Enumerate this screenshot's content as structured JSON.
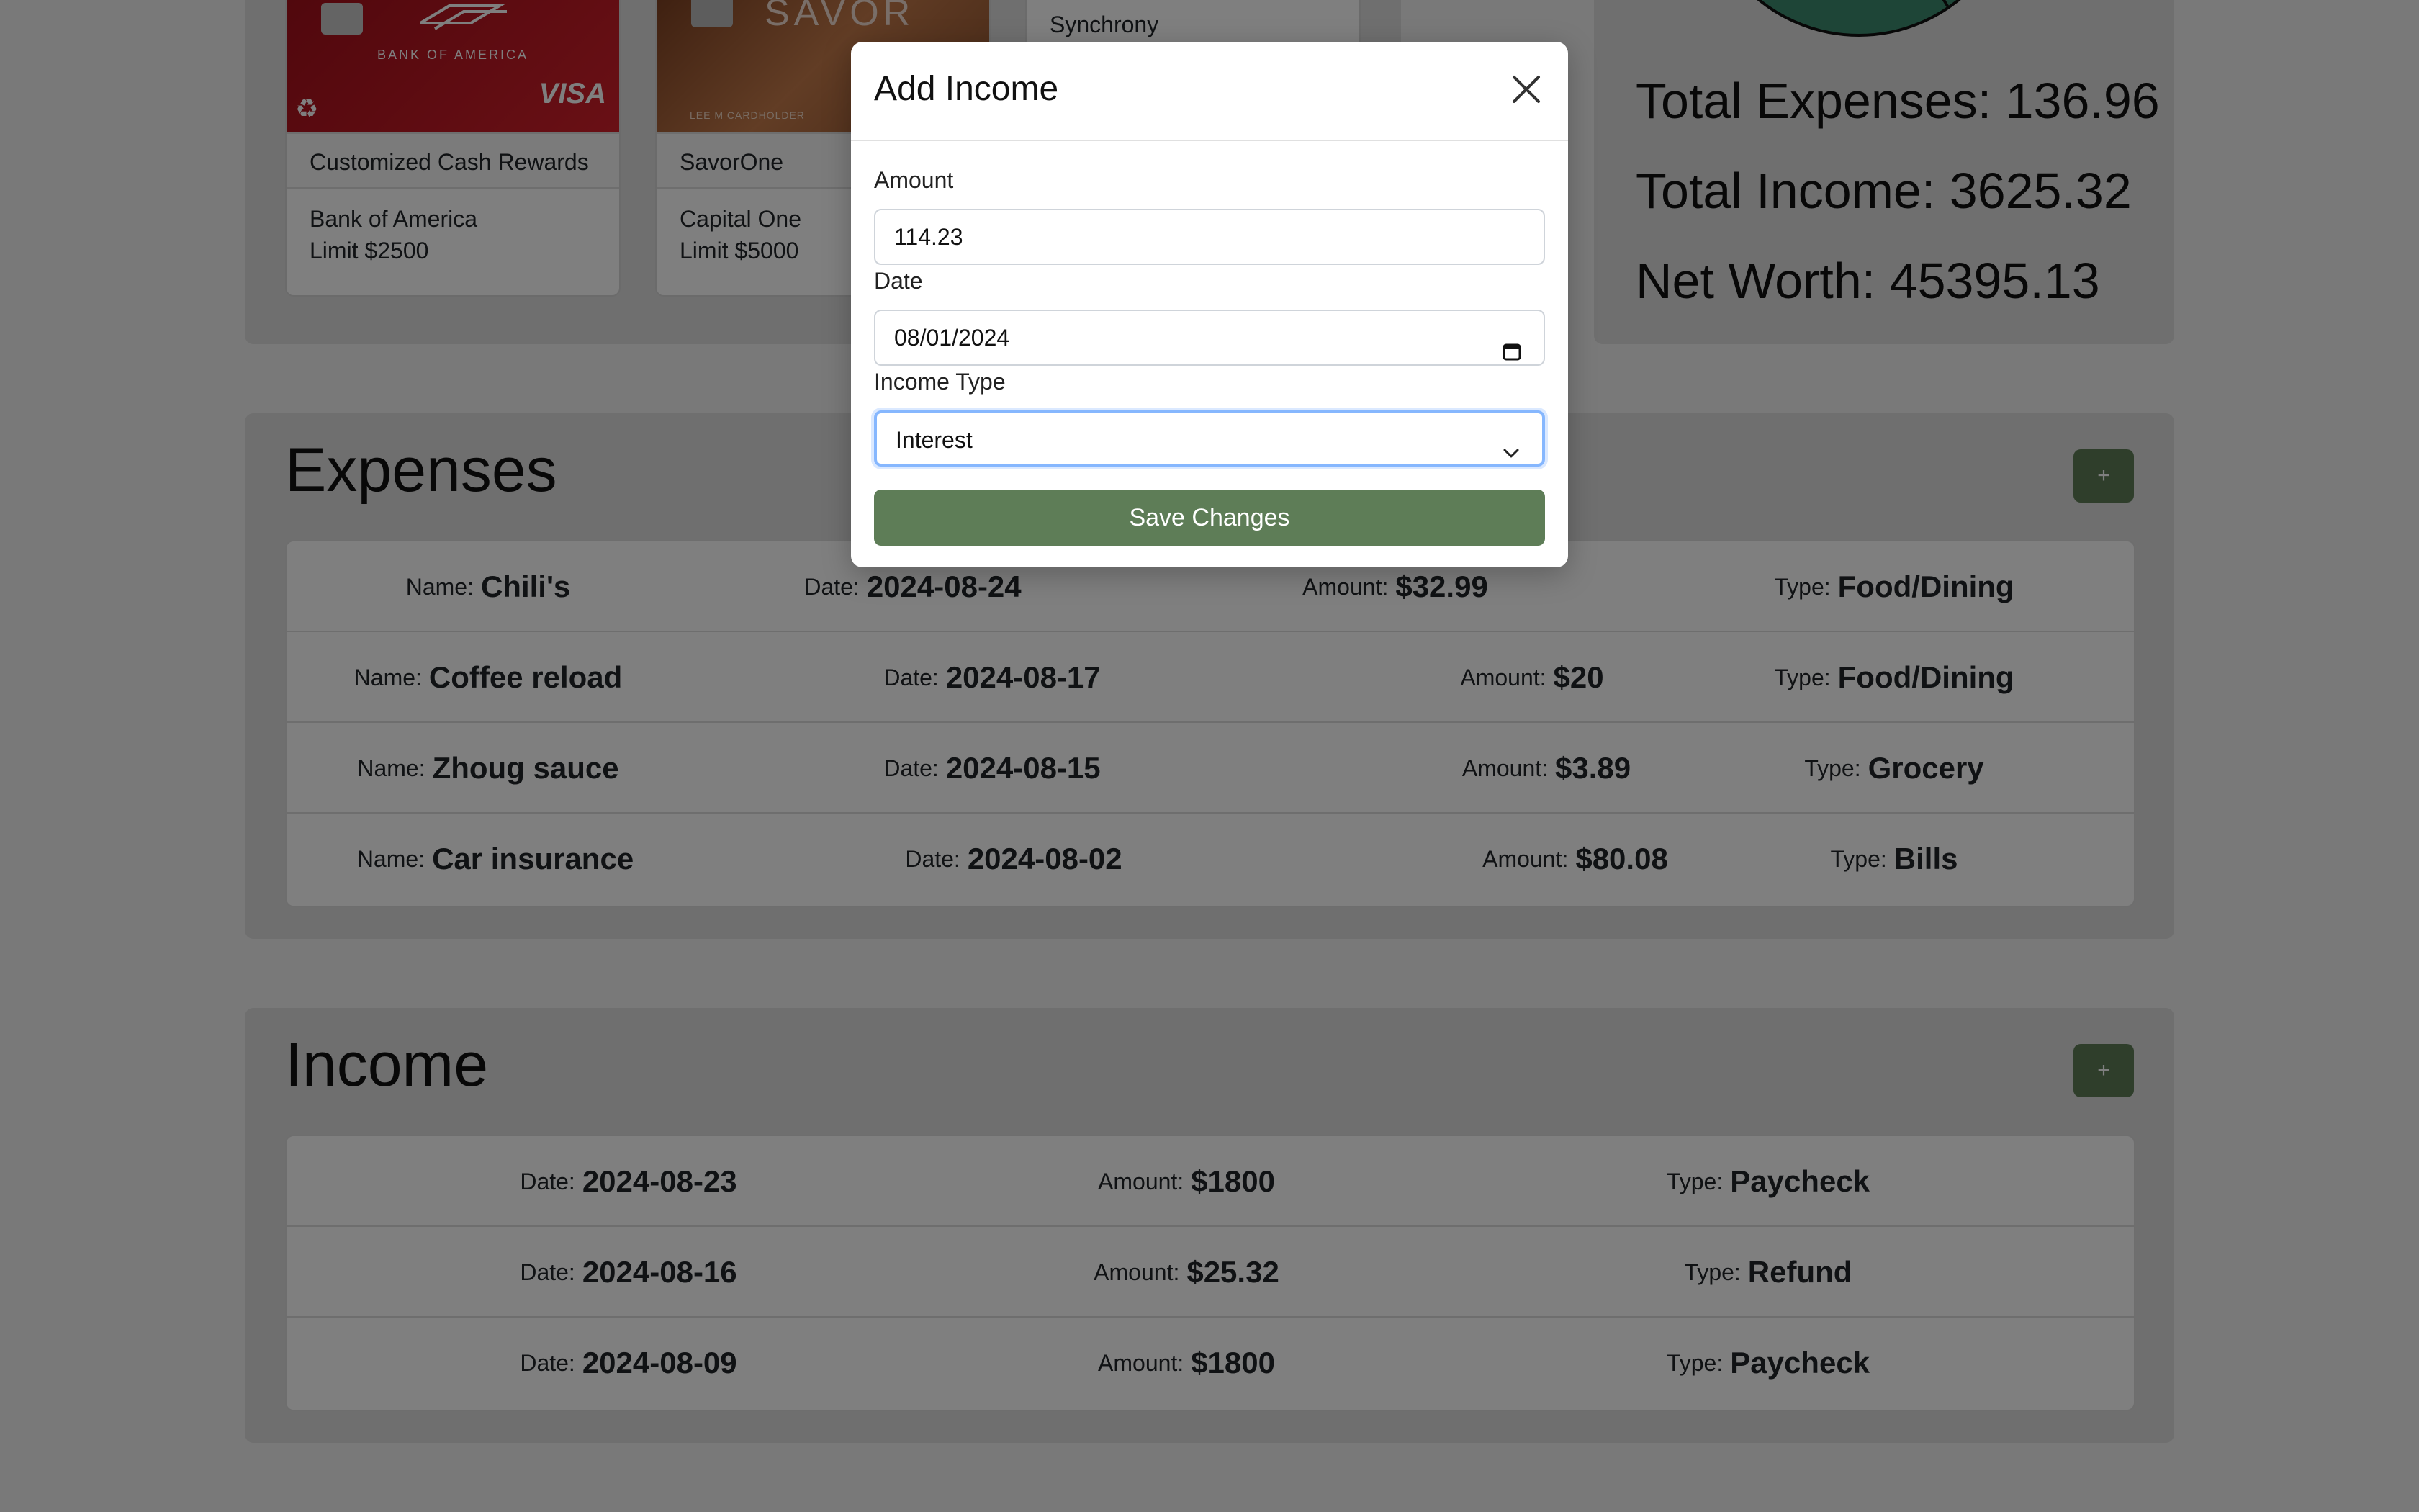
{
  "cards": [
    {
      "name": "Customized Cash Rewards",
      "bank": "Bank of America",
      "limit": "Limit $2500",
      "image_text_1": "BANK OF AMERICA",
      "image_text_2": "VISA"
    },
    {
      "name": "SavorOne",
      "bank": "Capital One",
      "limit": "Limit $5000",
      "image_text_1": "SAVOR",
      "image_text_2": "LEE M CARDHOLDER"
    },
    {
      "name": "Synchrony"
    }
  ],
  "summary": {
    "total_expenses": "Total Expenses: 136.96",
    "total_income": "Total Income: 3625.32",
    "net_worth": "Net Worth: 45395.13"
  },
  "expenses": {
    "title": "Expenses",
    "add_label": "+",
    "rows": [
      {
        "name": "Chili's",
        "date": "2024-08-24",
        "amount": "$32.99",
        "type": "Food/Dining"
      },
      {
        "name": "Coffee reload",
        "date": "2024-08-17",
        "amount": "$20",
        "type": "Food/Dining"
      },
      {
        "name": "Zhoug sauce",
        "date": "2024-08-15",
        "amount": "$3.89",
        "type": "Grocery"
      },
      {
        "name": "Car insurance",
        "date": "2024-08-02",
        "amount": "$80.08",
        "type": "Bills"
      }
    ]
  },
  "income": {
    "title": "Income",
    "add_label": "+",
    "rows": [
      {
        "date": "2024-08-23",
        "amount": "$1800",
        "type": "Paycheck"
      },
      {
        "date": "2024-08-16",
        "amount": "$25.32",
        "type": "Refund"
      },
      {
        "date": "2024-08-09",
        "amount": "$1800",
        "type": "Paycheck"
      }
    ]
  },
  "labels": {
    "name": "Name:",
    "date": "Date:",
    "amount": "Amount:",
    "type": "Type:"
  },
  "modal": {
    "title": "Add Income",
    "amount_label": "Amount",
    "amount_value": "114.23",
    "date_label": "Date",
    "date_value": "08/01/2024",
    "income_type_label": "Income Type",
    "income_type_value": "Interest",
    "save_label": "Save Changes"
  },
  "colors": {
    "accent": "#5e7d57",
    "pie": "#3c8a6f"
  }
}
